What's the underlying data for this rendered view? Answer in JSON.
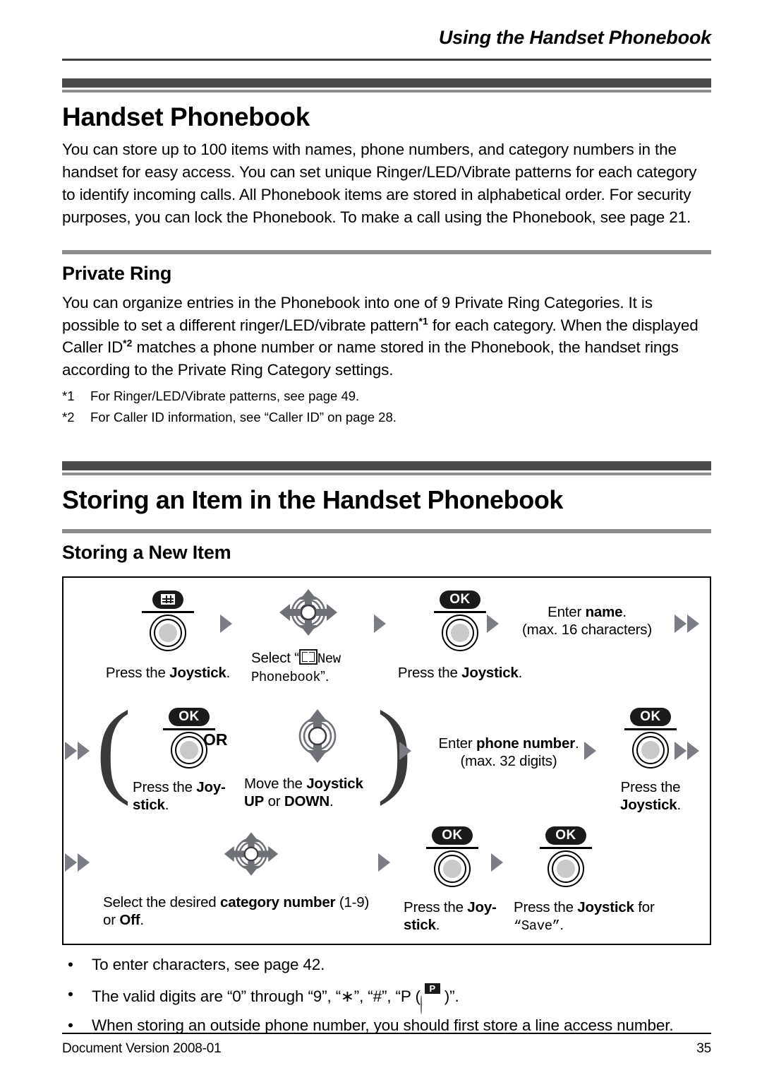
{
  "page": {
    "running_head": "Using the Handset Phonebook",
    "footer_left": "Document Version  2008-01",
    "footer_page": "35"
  },
  "chapter": {
    "title": "Handset Phonebook",
    "intro": "You can store up to 100 items with names, phone numbers, and category numbers in the handset for easy access. You can set unique Ringer/LED/Vibrate patterns for each category to identify incoming calls. All Phonebook items are stored in alphabetical order. For security purposes, you can lock the Phonebook. To make a call using the Phonebook, see page 21."
  },
  "private_ring": {
    "heading": "Private Ring",
    "para_1": "You can organize entries in the Phonebook into one of 9 Private Ring Categories. It is possible to set a different ringer/LED/vibrate pattern",
    "ref_1": "*1",
    "para_2": " for each category. When the displayed Caller ID",
    "ref_2": "*2",
    "para_3": " matches a phone number or name stored in the Phonebook, the handset rings according to the Private Ring Category settings.",
    "footnotes": [
      {
        "marker": "*1",
        "text": "For Ringer/LED/Vibrate patterns, see page 49."
      },
      {
        "marker": "*2",
        "text": "For Caller ID information, see “Caller ID” on page 28."
      }
    ]
  },
  "storing": {
    "title": "Storing an Item in the Handset Phonebook",
    "heading": "Storing a New Item"
  },
  "flow": {
    "step_1": {
      "key_label": "grid-menu",
      "caption_plain": "Press the ",
      "caption_bold": "Joystick",
      "caption_tail": "."
    },
    "step_2": {
      "caption_lead": "Select “",
      "mono_text": "New Phonebook",
      "caption_tail": "”."
    },
    "step_3": {
      "key_label": "OK",
      "caption_plain": "Press the ",
      "caption_bold": "Joystick",
      "caption_tail": "."
    },
    "step_4": {
      "line_1_plain": "Enter ",
      "line_1_bold": "name",
      "line_1_tail": ".",
      "line_2": "(max. 16 characters)"
    },
    "step_5": {
      "key_label": "OK",
      "caption_plain": "Press the ",
      "caption_bold": "Joy-",
      "caption_bold_2": "stick",
      "caption_tail": "."
    },
    "or_label": "OR",
    "step_6": {
      "caption_plain": "Move the ",
      "caption_bold": "Joystick",
      "caption_bold_2": "UP",
      "caption_mid": " or ",
      "caption_bold_3": "DOWN",
      "caption_tail": "."
    },
    "step_7": {
      "line_1_plain": "Enter ",
      "line_1_bold": "phone number",
      "line_1_tail": ".",
      "line_2": "(max. 32 digits)"
    },
    "step_8": {
      "key_label": "OK",
      "caption_plain": "Press the",
      "caption_bold": "Joystick",
      "caption_tail": "."
    },
    "step_9": {
      "caption_plain": "Select the desired ",
      "caption_bold": "category number",
      "caption_mid": " (1-9)",
      "caption_line2_plain": "or ",
      "caption_line2_bold": "Off",
      "caption_tail": "."
    },
    "step_10": {
      "key_label": "OK",
      "caption_plain": "Press the ",
      "caption_bold": "Joy-",
      "caption_bold_2": "stick",
      "caption_tail": "."
    },
    "step_11": {
      "key_label": "OK",
      "caption_plain": "Press the ",
      "caption_bold": "Joystick",
      "caption_mid": " for",
      "caption_mono": "“Save”",
      "caption_tail": "."
    }
  },
  "notes": [
    {
      "text": "To enter characters, see page 42."
    },
    {
      "pre": "The valid digits are “0” through “9”, “∗”, “#”, “P (",
      "post": ")”."
    },
    {
      "text": "When storing an outside phone number, you should first store a line access number."
    }
  ],
  "colors": {
    "band_dark": "#4a4a4a",
    "band_light": "#8c8c8c",
    "arrow_gray": "#7a7d85",
    "key_black": "#1a1a1a",
    "joystick_fill": "#c9c9c9"
  }
}
